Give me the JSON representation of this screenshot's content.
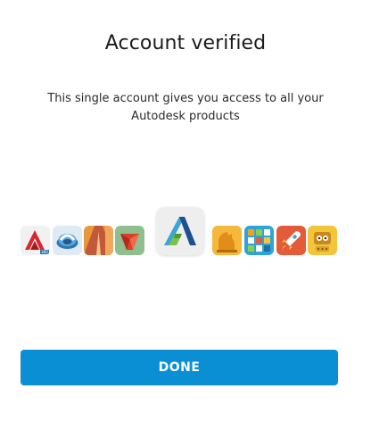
{
  "header": {
    "title": "Account verified"
  },
  "message": {
    "line1": "This single account gives you access to all your",
    "line2": "Autodesk products"
  },
  "product_icons": [
    {
      "name": "autocad-360-icon",
      "badge": "360",
      "color": "#d9262c"
    },
    {
      "name": "autodesk-360-icon",
      "color": "#2a78b8"
    },
    {
      "name": "sketchbook-icon",
      "color": "#e8973a"
    },
    {
      "name": "fusion-icon",
      "color": "#d9402a"
    },
    {
      "name": "autodesk-logo-icon",
      "color": "#2e6fb5"
    },
    {
      "name": "123d-make-icon",
      "color": "#f2a21e"
    },
    {
      "name": "123d-catch-icon",
      "color": "#2fa4d8"
    },
    {
      "name": "pixlr-rocket-icon",
      "color": "#e45b3a"
    },
    {
      "name": "tinkerplay-robot-icon",
      "color": "#f2c53a"
    }
  ],
  "footer": {
    "done_label": "DONE"
  }
}
